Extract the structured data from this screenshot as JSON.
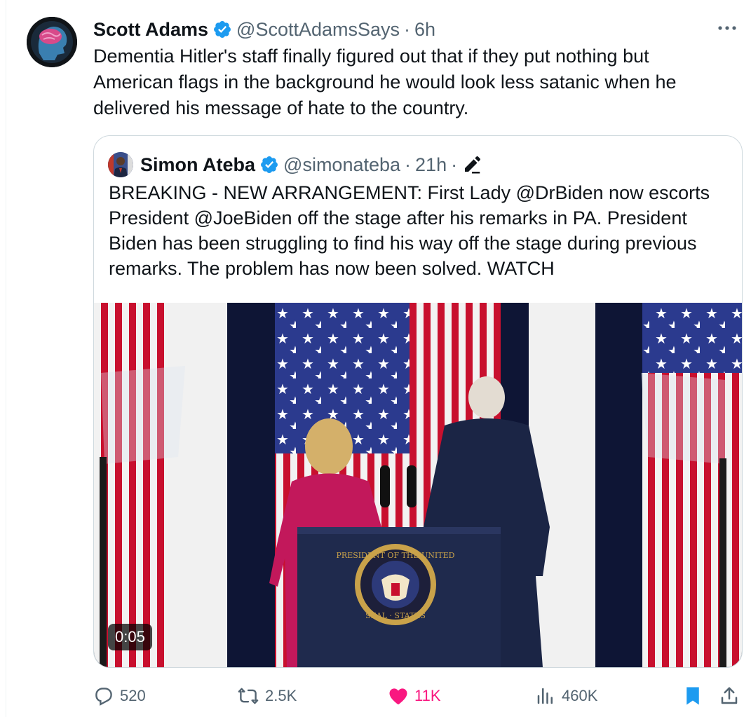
{
  "tweet": {
    "author_name": "Scott Adams",
    "author_handle": "@ScottAdamsSays",
    "separator": "·",
    "time": "6h",
    "text": "Dementia Hitler's staff finally figured out that if they put nothing but American flags in the background he would look less satanic when he delivered his message of hate to the country."
  },
  "quote": {
    "author_name": "Simon Ateba",
    "author_handle": "@simonateba",
    "separator": "·",
    "time": "21h",
    "edit_separator": "·",
    "text": "BREAKING - NEW ARRANGEMENT: First Lady @DrBiden now escorts President @JoeBiden off the stage after his remarks in PA. President Biden has been struggling to find his way off the stage during previous remarks. The problem has now been solved. WATCH",
    "video": {
      "timestamp": "0:05",
      "seal_top_text": "PRESIDENT OF THE UNITED",
      "seal_bottom_text": "SEAL · STATES"
    }
  },
  "actions": {
    "replies": "520",
    "reposts": "2.5K",
    "likes": "11K",
    "views": "460K"
  },
  "colors": {
    "verified": "#1d9bf0",
    "like": "#f91880",
    "bookmark": "#1d9bf0",
    "secondary_text": "#536471",
    "border": "#cfd9de"
  },
  "icons": [
    "verified-badge-icon",
    "more-icon",
    "edit-icon",
    "reply-icon",
    "repost-icon",
    "like-icon",
    "views-icon",
    "bookmark-icon",
    "share-icon"
  ]
}
